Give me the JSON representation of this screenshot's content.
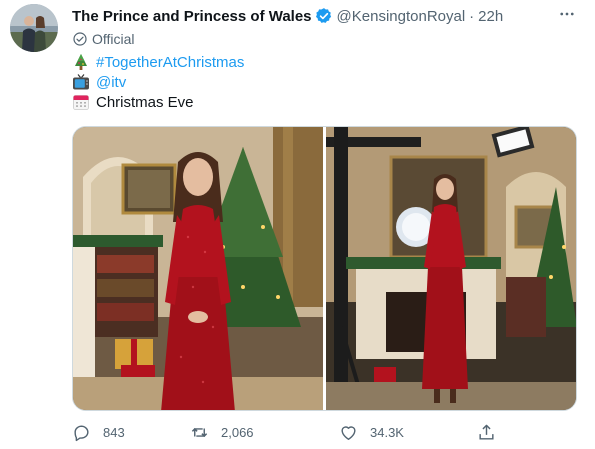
{
  "account": {
    "name": "The Prince and Princess of Wales",
    "handle": "@KensingtonRoyal",
    "separator": "·",
    "time": "22h",
    "label": "Official"
  },
  "tweet": {
    "lines": [
      {
        "emoji": "christmas-tree-icon",
        "text": "#TogetherAtChristmas",
        "is_link": true
      },
      {
        "emoji": "television-icon",
        "text": "@itv",
        "is_link": true
      },
      {
        "emoji": "calendar-icon",
        "text": "Christmas Eve",
        "is_link": false
      }
    ]
  },
  "media": {
    "photos": [
      {
        "name": "photo-left",
        "subject": "woman in red sequin dress in front of Christmas tree and fireplace"
      },
      {
        "name": "photo-right",
        "subject": "behind-the-scenes shot with studio light and camera in front of fireplace"
      }
    ]
  },
  "actions": {
    "reply_count": "843",
    "retweet_count": "2,066",
    "like_count": "34.3K"
  },
  "colors": {
    "link": "#1d9bf0",
    "verified": "#1d9bf0",
    "secondary_text": "#536471",
    "dress_red": "#b3121e"
  }
}
